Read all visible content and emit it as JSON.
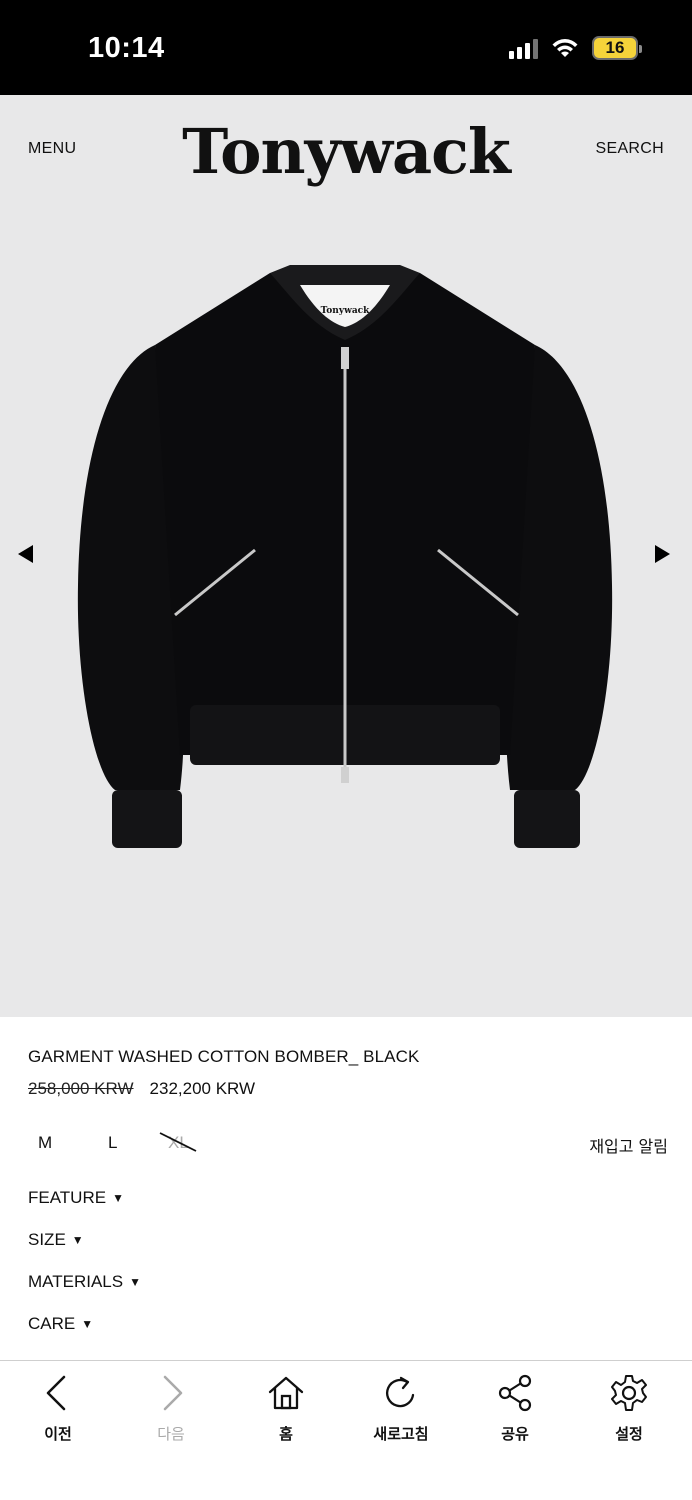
{
  "status_bar": {
    "time": "10:14",
    "battery": "16"
  },
  "header": {
    "menu_label": "MENU",
    "brand": "Tonywack",
    "search_label": "SEARCH"
  },
  "product": {
    "image_label_brand": "Tonywack",
    "name": "GARMENT WASHED COTTON BOMBER_ BLACK",
    "original_price": "258,000 KRW",
    "sale_price": "232,200 KRW",
    "sizes": [
      {
        "label": "M",
        "available": true
      },
      {
        "label": "L",
        "available": true
      },
      {
        "label": "XL",
        "available": false
      }
    ],
    "restock_label": "재입고 알림",
    "sections": [
      {
        "label": "FEATURE"
      },
      {
        "label": "SIZE"
      },
      {
        "label": "MATERIALS"
      },
      {
        "label": "CARE"
      }
    ]
  },
  "toolbar": {
    "items": [
      {
        "label": "이전",
        "icon": "chevron-left-icon"
      },
      {
        "label": "다음",
        "icon": "chevron-right-icon"
      },
      {
        "label": "홈",
        "icon": "home-icon"
      },
      {
        "label": "새로고침",
        "icon": "refresh-icon"
      },
      {
        "label": "공유",
        "icon": "share-icon"
      },
      {
        "label": "설정",
        "icon": "gear-icon"
      }
    ]
  },
  "colors": {
    "hero_background": "#e8e8e9",
    "status_bar": "#000000",
    "battery": "#f5d33a"
  }
}
